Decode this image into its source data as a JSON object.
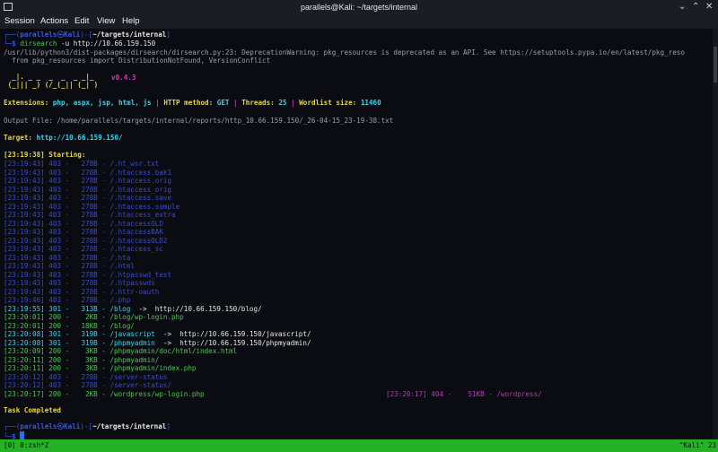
{
  "window": {
    "title": "parallels@Kali: ~/targets/internal",
    "minimize": "⌄",
    "maximize": "⌃",
    "close": "✕"
  },
  "menu": [
    "Session",
    "Actions",
    "Edit",
    "View",
    "Help"
  ],
  "terminal": {
    "prompt1": {
      "user": "parallels",
      "at": "㉿",
      "host": "Kali",
      "path": "~/targets/internal",
      "cmd": "dirsearch",
      "args": " -u http://10.66.159.150"
    },
    "warning1": "/usr/lib/python3/dist-packages/dirsearch/dirsearch.py:23: DeprecationWarning: pkg_resources is deprecated as an API. See https://setuptools.pypa.io/en/latest/pkg_reso",
    "warning2": "  from pkg_resources import DistributionNotFound, VersionConflict",
    "logo1": "  _|. _ _  _  _  _ _|_",
    "logo2": " (_||| _) (/_(_|| (_| )",
    "version": "v0.4.3",
    "ext_label": "Extensions: ",
    "ext_value": "php, aspx, jsp, html, js",
    "sep": " | ",
    "method_label": "HTTP method: ",
    "method_value": "GET",
    "threads_label": "Threads: ",
    "threads_value": "25",
    "wordlist_label": "Wordlist size: ",
    "wordlist_value": "11460",
    "output_file": "Output File: /home/parallels/targets/internal/reports/http_10.66.159.150/_26-04-15_23-19-38.txt",
    "target_label": "Target: ",
    "target_value": "http://10.66.159.150/",
    "starting_ts": "[23:19:38]",
    "starting_label": " Starting:",
    "results": [
      {
        "ts": "[23:19:43]",
        "code": "403",
        "size": "278B",
        "path": "/.ht_wsr.txt",
        "redirect": "",
        "kind": "forbidden"
      },
      {
        "ts": "[23:19:43]",
        "code": "403",
        "size": "278B",
        "path": "/.htaccess.bak1",
        "redirect": "",
        "kind": "forbidden"
      },
      {
        "ts": "[23:19:43]",
        "code": "403",
        "size": "278B",
        "path": "/.htaccess.orig",
        "redirect": "",
        "kind": "forbidden"
      },
      {
        "ts": "[23:19:43]",
        "code": "403",
        "size": "278B",
        "path": "/.htaccess_orig",
        "redirect": "",
        "kind": "forbidden"
      },
      {
        "ts": "[23:19:43]",
        "code": "403",
        "size": "278B",
        "path": "/.htaccess.save",
        "redirect": "",
        "kind": "forbidden"
      },
      {
        "ts": "[23:19:43]",
        "code": "403",
        "size": "278B",
        "path": "/.htaccess.sample",
        "redirect": "",
        "kind": "forbidden"
      },
      {
        "ts": "[23:19:43]",
        "code": "403",
        "size": "278B",
        "path": "/.htaccess_extra",
        "redirect": "",
        "kind": "forbidden"
      },
      {
        "ts": "[23:19:43]",
        "code": "403",
        "size": "278B",
        "path": "/.htaccessOLD",
        "redirect": "",
        "kind": "forbidden"
      },
      {
        "ts": "[23:19:43]",
        "code": "403",
        "size": "278B",
        "path": "/.htaccessBAK",
        "redirect": "",
        "kind": "forbidden"
      },
      {
        "ts": "[23:19:43]",
        "code": "403",
        "size": "278B",
        "path": "/.htaccessOLD2",
        "redirect": "",
        "kind": "forbidden"
      },
      {
        "ts": "[23:19:43]",
        "code": "403",
        "size": "278B",
        "path": "/.htaccess_sc",
        "redirect": "",
        "kind": "forbidden"
      },
      {
        "ts": "[23:19:43]",
        "code": "403",
        "size": "278B",
        "path": "/.hta",
        "redirect": "",
        "kind": "forbidden"
      },
      {
        "ts": "[23:19:43]",
        "code": "403",
        "size": "278B",
        "path": "/.html",
        "redirect": "",
        "kind": "forbidden"
      },
      {
        "ts": "[23:19:43]",
        "code": "403",
        "size": "278B",
        "path": "/.htpasswd_test",
        "redirect": "",
        "kind": "forbidden"
      },
      {
        "ts": "[23:19:43]",
        "code": "403",
        "size": "278B",
        "path": "/.htpasswds",
        "redirect": "",
        "kind": "forbidden"
      },
      {
        "ts": "[23:19:43]",
        "code": "403",
        "size": "278B",
        "path": "/.httr-oauth",
        "redirect": "",
        "kind": "forbidden"
      },
      {
        "ts": "[23:19:46]",
        "code": "403",
        "size": "278B",
        "path": "/.php",
        "redirect": "",
        "kind": "forbidden"
      },
      {
        "ts": "[23:19:55]",
        "code": "301",
        "size": "313B",
        "path": "/blog",
        "redirect": "http://10.66.159.150/blog/",
        "kind": "redirect"
      },
      {
        "ts": "[23:20:01]",
        "code": "200",
        "size": "2KB",
        "path": "/blog/wp-login.php",
        "redirect": "",
        "kind": "ok"
      },
      {
        "ts": "[23:20:01]",
        "code": "200",
        "size": "18KB",
        "path": "/blog/",
        "redirect": "",
        "kind": "ok"
      },
      {
        "ts": "[23:20:08]",
        "code": "301",
        "size": "319B",
        "path": "/javascript",
        "redirect": "http://10.66.159.150/javascript/",
        "kind": "redirect"
      },
      {
        "ts": "[23:20:08]",
        "code": "301",
        "size": "319B",
        "path": "/phpmyadmin",
        "redirect": "http://10.66.159.150/phpmyadmin/",
        "kind": "redirect"
      },
      {
        "ts": "[23:20:09]",
        "code": "200",
        "size": "3KB",
        "path": "/phpmyadmin/doc/html/index.html",
        "redirect": "",
        "kind": "ok"
      },
      {
        "ts": "[23:20:11]",
        "code": "200",
        "size": "3KB",
        "path": "/phpmyadmin/",
        "redirect": "",
        "kind": "ok"
      },
      {
        "ts": "[23:20:11]",
        "code": "200",
        "size": "3KB",
        "path": "/phpmyadmin/index.php",
        "redirect": "",
        "kind": "ok"
      },
      {
        "ts": "[23:20:12]",
        "code": "403",
        "size": "278B",
        "path": "/server-status",
        "redirect": "",
        "kind": "forbidden"
      },
      {
        "ts": "[23:20:12]",
        "code": "403",
        "size": "278B",
        "path": "/server-status/",
        "redirect": "",
        "kind": "forbidden"
      },
      {
        "ts": "[23:20:17]",
        "code": "200",
        "size": "2KB",
        "path": "/wordpress/wp-login.php",
        "redirect": "",
        "kind": "ok"
      }
    ],
    "right_result": {
      "ts": "[23:20:17]",
      "code": "404",
      "size": "51KB",
      "path": "/wordpress/"
    },
    "arrow": "->",
    "task_completed": "Task Completed",
    "prompt2": {
      "user": "parallels",
      "at": "㉿",
      "host": "Kali",
      "path": "~/targets/internal",
      "cmd": ""
    }
  },
  "statusbar": {
    "left": "[0] 0:zsh*Z",
    "right": "\"Kali\" 23"
  },
  "colors": {
    "green": "#24b324",
    "cyan": "#38d6ee",
    "blue": "#3c4cc8",
    "yellow": "#e8d640",
    "magenta": "#d33ab8",
    "red": "#cf3131"
  }
}
